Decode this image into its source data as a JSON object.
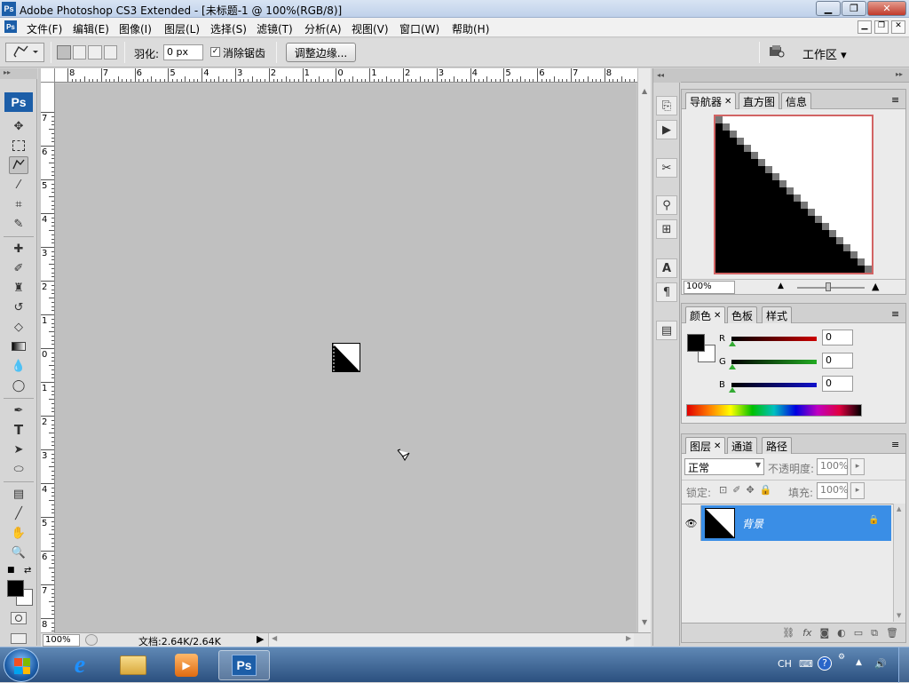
{
  "window": {
    "title": "Adobe Photoshop CS3 Extended - [未标题-1 @ 100%(RGB/8)]",
    "app_logo": "Ps"
  },
  "menu": [
    "文件(F)",
    "编辑(E)",
    "图像(I)",
    "图层(L)",
    "选择(S)",
    "滤镜(T)",
    "分析(A)",
    "视图(V)",
    "窗口(W)",
    "帮助(H)"
  ],
  "options": {
    "feather_label": "羽化:",
    "feather_value": "0 px",
    "antialias_label": "消除锯齿",
    "antialias_checked": true,
    "refine_edge_label": "调整边缘...",
    "workspace_label": "工作区 ▾"
  },
  "toolbox": {
    "logo": "Ps",
    "tools": [
      "move-tool",
      "marquee-tool",
      "lasso-tool",
      "magic-wand-tool",
      "crop-tool",
      "slice-tool",
      "healing-brush-tool",
      "brush-tool",
      "clone-stamp-tool",
      "history-brush-tool",
      "eraser-tool",
      "gradient-tool",
      "blur-tool",
      "dodge-tool",
      "pen-tool",
      "type-tool",
      "path-selection-tool",
      "shape-tool",
      "notes-tool",
      "eyedropper-tool",
      "hand-tool",
      "zoom-tool"
    ],
    "foreground_color": "#000000",
    "background_color": "#ffffff"
  },
  "rulers": {
    "horizontal": [
      "8",
      "7",
      "6",
      "5",
      "4",
      "3",
      "2",
      "1",
      "0",
      "1",
      "2",
      "3",
      "4",
      "5",
      "6",
      "7",
      "8"
    ],
    "vertical": [
      "7",
      "6",
      "5",
      "4",
      "3",
      "2",
      "1",
      "0",
      "1",
      "2",
      "3",
      "4",
      "5",
      "6",
      "7",
      "8"
    ]
  },
  "status": {
    "zoom": "100%",
    "doc_info": "文档:2.64K/2.64K"
  },
  "navigator": {
    "tabs": [
      "导航器",
      "直方图",
      "信息"
    ],
    "zoom": "100%",
    "highlight_color": "#d26464"
  },
  "color_panel": {
    "tabs": [
      "颜色",
      "色板",
      "样式"
    ],
    "channels": [
      {
        "label": "R",
        "value": "0",
        "color": "#cc0000"
      },
      {
        "label": "G",
        "value": "0",
        "color": "#22aa22"
      },
      {
        "label": "B",
        "value": "0",
        "color": "#1111cc"
      }
    ]
  },
  "layers_panel": {
    "tabs": [
      "图层",
      "通道",
      "路径"
    ],
    "blend_mode": "正常",
    "opacity_label": "不透明度:",
    "opacity_value": "100%",
    "lock_label": "锁定:",
    "fill_label": "填充:",
    "fill_value": "100%",
    "layer_name": "背景",
    "layer_selected_color": "#3a8ee6"
  },
  "tray": {
    "lang": "CH"
  }
}
